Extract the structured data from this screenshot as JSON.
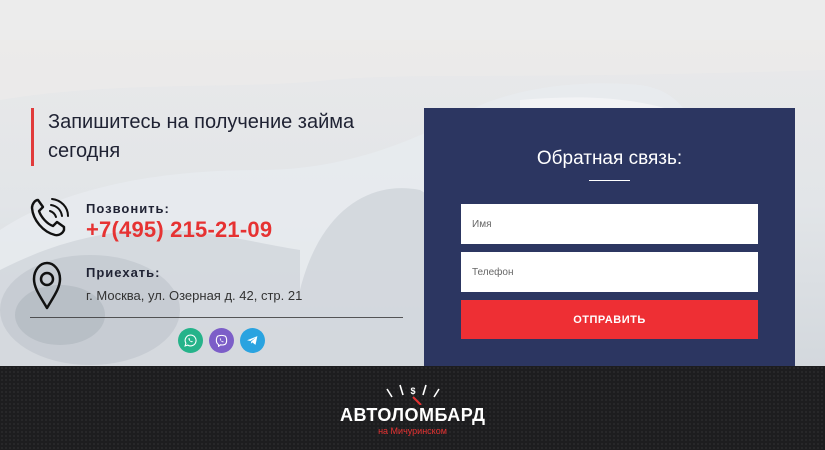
{
  "hero": {
    "heading": "Запишитесь на получение займа сегодня"
  },
  "contacts": {
    "phone_label": "Позвонить:",
    "phone_number": "+7(495) 215-21-09",
    "address_label": "Приехать:",
    "address": "г. Москва, ул. Озерная д. 42, стр. 21"
  },
  "socials": [
    {
      "name": "whatsapp",
      "icon": "whatsapp-icon",
      "color": "#25b38a"
    },
    {
      "name": "viber",
      "icon": "viber-icon",
      "color": "#7c5ec8"
    },
    {
      "name": "telegram",
      "icon": "telegram-icon",
      "color": "#2aa3e0"
    }
  ],
  "form": {
    "title": "Обратная связь:",
    "name_placeholder": "Имя",
    "phone_placeholder": "Телефон",
    "submit_label": "ОТПРАВИТЬ"
  },
  "footer": {
    "logo_main": "АВТОЛОМБАРД",
    "logo_sub": "на Мичуринском"
  },
  "colors": {
    "accent": "#e63232",
    "panel": "#2c3661",
    "footer": "#1d1d1f"
  }
}
